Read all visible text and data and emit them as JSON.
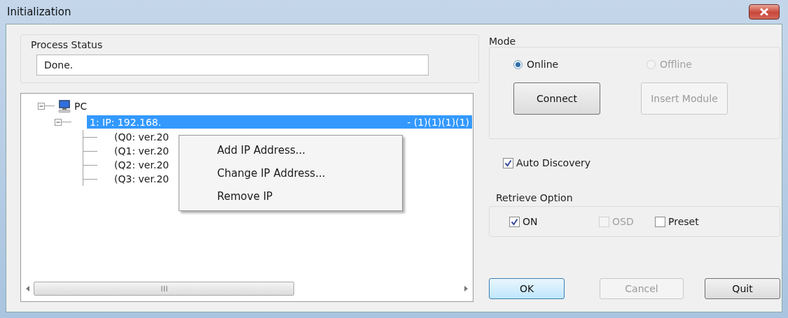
{
  "window": {
    "title": "Initialization"
  },
  "process_status": {
    "label": "Process Status",
    "value": "Done."
  },
  "tree": {
    "items": [
      {
        "label": "PC",
        "expanded": true,
        "children": [
          {
            "label": "1: IP: 192.168.",
            "label_end": "- (1)(1)(1)(1)",
            "selected": true,
            "expanded": true,
            "children": [
              {
                "label": "(Q0: ver.20"
              },
              {
                "label": "(Q1: ver.20"
              },
              {
                "label": "(Q2: ver.20"
              },
              {
                "label": "(Q3: ver.20"
              }
            ]
          }
        ]
      }
    ]
  },
  "context_menu": {
    "items": [
      "Add IP Address...",
      "Change IP Address...",
      "Remove IP"
    ]
  },
  "mode": {
    "label": "Mode",
    "options": [
      {
        "label": "Online",
        "selected": true,
        "disabled": false
      },
      {
        "label": "Offline",
        "selected": false,
        "disabled": true
      }
    ],
    "buttons": [
      {
        "label": "Connect",
        "disabled": false
      },
      {
        "label": "Insert Module",
        "disabled": true
      }
    ]
  },
  "auto_discovery": {
    "label": "Auto Discovery",
    "checked": true
  },
  "retrieve_option": {
    "label": "Retrieve Option",
    "options": [
      {
        "label": "ON",
        "checked": true,
        "disabled": false
      },
      {
        "label": "OSD",
        "checked": false,
        "disabled": true
      },
      {
        "label": "Preset",
        "checked": false,
        "disabled": false
      }
    ]
  },
  "buttons": [
    {
      "label": "OK",
      "default": true,
      "disabled": false
    },
    {
      "label": "Cancel",
      "default": false,
      "disabled": true
    },
    {
      "label": "Quit",
      "default": false,
      "disabled": false
    }
  ]
}
